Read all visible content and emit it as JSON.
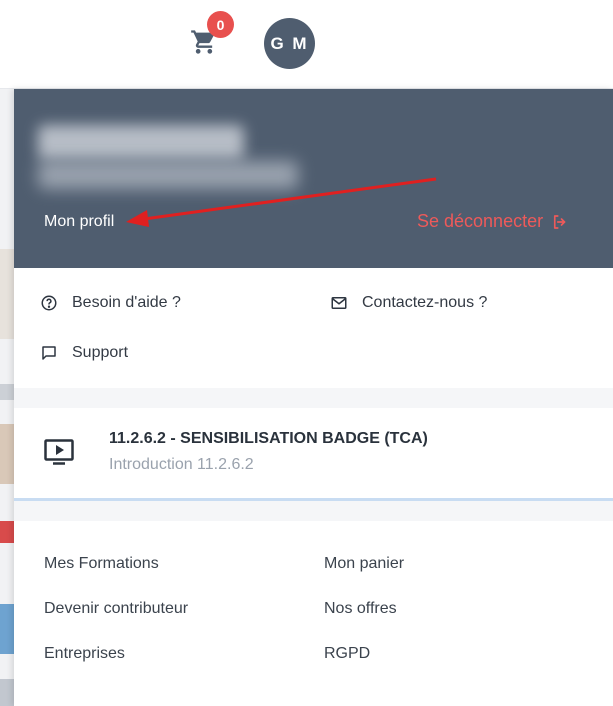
{
  "header": {
    "cart_count": "0",
    "avatar_initials": "G M",
    "cart_icon": "cart-icon"
  },
  "profile": {
    "profile_link": "Mon profil",
    "logout_label": "Se déconnecter",
    "logout_icon": "logout-icon",
    "annotation_color": "#e02020"
  },
  "help": {
    "help_label": "Besoin d'aide ?",
    "help_icon": "question-circle-icon",
    "contact_label": "Contactez-nous ?",
    "contact_icon": "envelope-icon",
    "support_label": "Support",
    "support_icon": "chat-bubble-icon"
  },
  "course": {
    "icon": "video-play-icon",
    "title": "11.2.6.2 - SENSIBILISATION BADGE (TCA)",
    "subtitle": "Introduction 11.2.6.2"
  },
  "links": {
    "col1": [
      "Mes Formations",
      "Devenir contributeur",
      "Entreprises"
    ],
    "col2": [
      "Mon panier",
      "Nos offres",
      "RGPD"
    ]
  },
  "colors": {
    "profile_bg": "#4f5d6f",
    "accent_red": "#ee5a5a",
    "badge_red": "#e8504e"
  }
}
